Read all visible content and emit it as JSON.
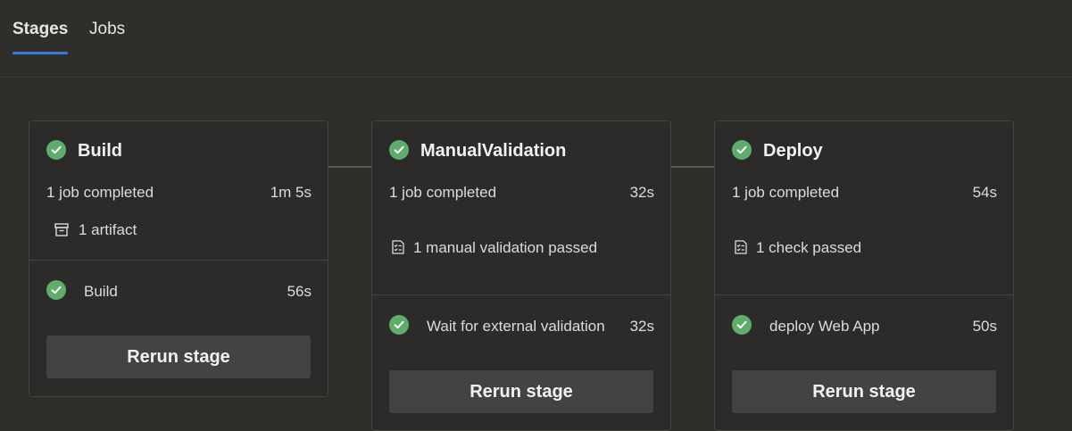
{
  "tabs": {
    "stages": "Stages",
    "jobs": "Jobs"
  },
  "stages": [
    {
      "title": "Build",
      "summary": "1 job completed",
      "duration": "1m 5s",
      "detail_icon": "artifact-icon",
      "detail": "1 artifact",
      "job_name": "Build",
      "job_duration": "56s",
      "button": "Rerun stage"
    },
    {
      "title": "ManualValidation",
      "summary": "1 job completed",
      "duration": "32s",
      "detail_icon": "checklist-icon",
      "detail": "1 manual validation passed",
      "job_name": "Wait for external validation",
      "job_duration": "32s",
      "button": "Rerun stage"
    },
    {
      "title": "Deploy",
      "summary": "1 job completed",
      "duration": "54s",
      "detail_icon": "checklist-icon",
      "detail": "1 check passed",
      "job_name": "deploy Web App",
      "job_duration": "50s",
      "button": "Rerun stage"
    }
  ],
  "colors": {
    "background": "#302e2b",
    "card": "#2c2b29",
    "success": "#5fad6b",
    "accent": "#2f7fd6",
    "button": "#454341"
  }
}
